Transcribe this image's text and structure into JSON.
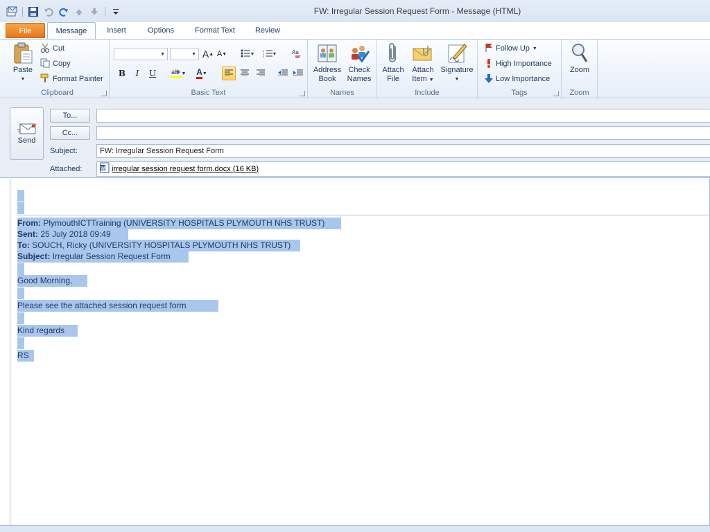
{
  "window": {
    "title": "FW: Irregular Session Request Form  -  Message (HTML)"
  },
  "tabs": [
    "File",
    "Message",
    "Insert",
    "Options",
    "Format Text",
    "Review"
  ],
  "ribbon": {
    "clipboard": {
      "label": "Clipboard",
      "paste": "Paste",
      "cut": "Cut",
      "copy": "Copy",
      "format_painter": "Format Painter"
    },
    "basic_text": {
      "label": "Basic Text",
      "bold": "B",
      "italic": "I",
      "underline": "U",
      "font_grow": "A",
      "font_shrink": "A",
      "font_color_letter": "A"
    },
    "names": {
      "label": "Names",
      "address_book_1": "Address",
      "address_book_2": "Book",
      "check_names_1": "Check",
      "check_names_2": "Names"
    },
    "include": {
      "label": "Include",
      "attach_file_1": "Attach",
      "attach_file_2": "File",
      "attach_item_1": "Attach",
      "attach_item_2": "Item",
      "signature": "Signature"
    },
    "tags": {
      "label": "Tags",
      "follow_up": "Follow Up",
      "high_importance": "High Importance",
      "low_importance": "Low Importance"
    },
    "zoom": {
      "label": "Zoom",
      "zoom": "Zoom"
    }
  },
  "compose": {
    "send": "Send",
    "to_button": "To...",
    "cc_button": "Cc...",
    "to_value": "",
    "cc_value": "",
    "subject_label": "Subject:",
    "subject_value": "FW: Irregular Session Request Form",
    "attached_label": "Attached:",
    "attachment": "irregular session request form.docx (16 KB)"
  },
  "message_body": {
    "from_label": "From:",
    "from_value": "PlymouthICTTraining (UNIVERSITY HOSPITALS PLYMOUTH NHS TRUST)",
    "sent_label": "Sent:",
    "sent_value": "25 July 2018 09:49",
    "to_label": "To:",
    "to_value": "SOUCH, Ricky (UNIVERSITY HOSPITALS PLYMOUTH NHS TRUST)",
    "subject_label": "Subject:",
    "subject_value": "Irregular Session Request Form",
    "greeting": "Good Morning,",
    "line1": "Please see the attached session request form",
    "closing": "Kind regards",
    "signature": "RS"
  },
  "colors": {
    "selection": "#a9c7ec",
    "file_tab": "#e8761b",
    "ribbon_border": "#a9bcd6"
  }
}
